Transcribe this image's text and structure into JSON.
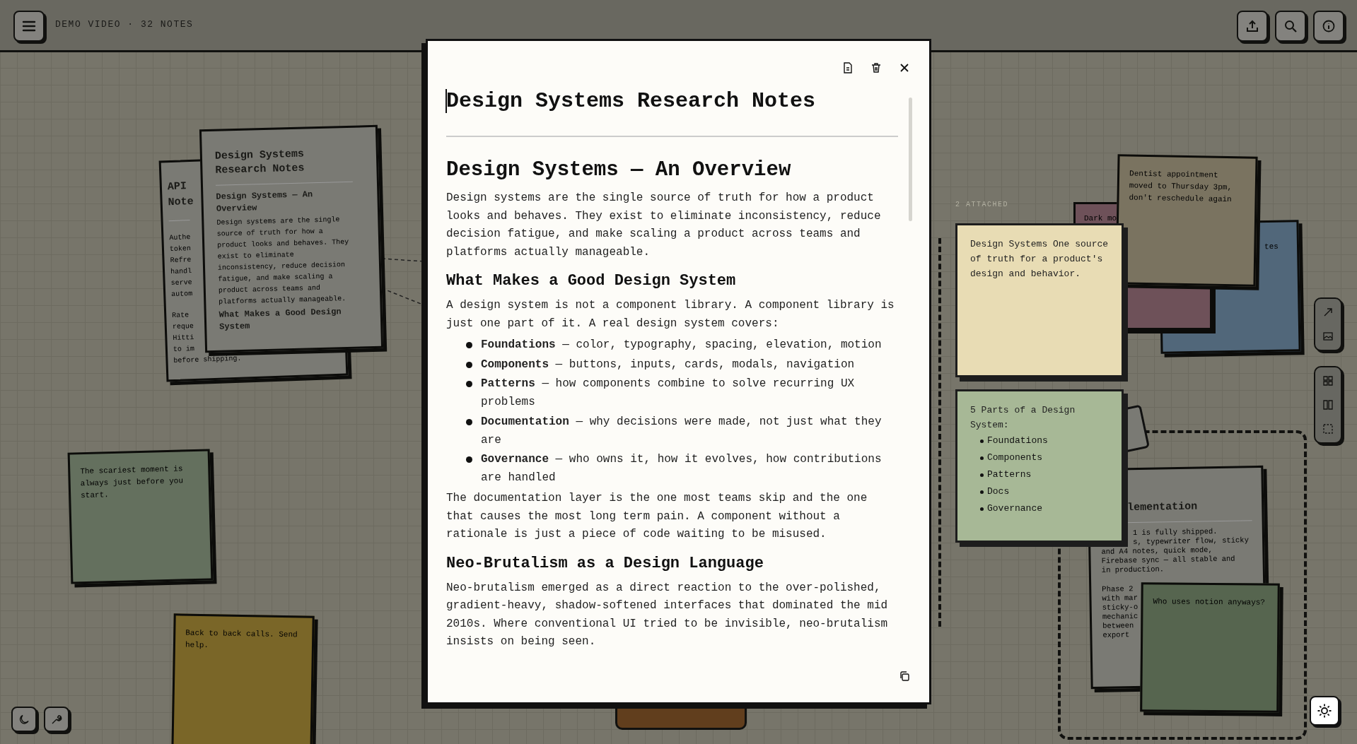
{
  "header": {
    "title": "DEMO VIDEO · 32 NOTES"
  },
  "canvas": {
    "attached_label": "2 ATTACHED",
    "notes": [
      {
        "kind": "doc",
        "title": "API Note",
        "paragraphs": [
          [
            "Authe",
            "token",
            "Refre",
            "handl",
            "serve",
            "autom"
          ],
          [
            "Rate",
            "reque",
            "Hitti",
            "to im",
            "before shipping."
          ]
        ],
        "highlighted": false,
        "color": "#7a7a74"
      },
      {
        "kind": "doc",
        "title": "Design Systems Research Notes",
        "heading": "Design Systems — An Overview",
        "text": "Design systems are the single source of truth for how a product looks and behaves. They exist to eliminate inconsistency, reduce decision fatigue, and make scaling a product across teams and platforms actually manageable.",
        "subheading": "What Makes a Good Design System",
        "highlighted": false,
        "color": "#7a7a74"
      },
      {
        "kind": "sticky",
        "text": "The scariest moment is always just before you start.",
        "highlighted": false,
        "color": "#64705e"
      },
      {
        "kind": "sticky",
        "text": "Back to back calls. Send help.",
        "highlighted": false,
        "color": "#7a6628"
      },
      {
        "kind": "sticky",
        "text": "Dark mo",
        "highlighted": false,
        "color": "#6e5159"
      },
      {
        "kind": "sticky",
        "text": "tes",
        "highlighted": false,
        "color": "#51677a"
      },
      {
        "kind": "sticky",
        "text": "Dentist appointment moved to Thursday 3pm, don't reschedule again",
        "highlighted": false,
        "color": "#7a7360"
      },
      {
        "kind": "sticky",
        "text": "Design Systems One source of truth for a product's design and behavior.",
        "highlighted": true,
        "color": "#e8dcb4"
      },
      {
        "kind": "sticky",
        "text": "5 Parts of a Design System:",
        "items": [
          "Foundations",
          "Components",
          "Patterns",
          "Docs",
          "Governance"
        ],
        "highlighted": true,
        "color": "#a7b896"
      },
      {
        "kind": "doc",
        "title": "lementation",
        "paragraphs": [
          [
            "1 is fully shipped.",
            "s, typewriter flow, sticky",
            "and A4 notes, quick mode,",
            "Firebase sync — all stable and",
            "in production."
          ],
          [
            "Phase 2",
            "with mar",
            "sticky-o",
            "mechanic",
            "between",
            "export"
          ]
        ],
        "highlighted": false,
        "color": "#7a7a74"
      },
      {
        "kind": "sticky",
        "text": "Who uses notion anyways?",
        "highlighted": false,
        "color": "#56654f"
      }
    ]
  },
  "modal": {
    "title": "Design Systems Research Notes",
    "content": [
      {
        "kind": "h1",
        "text": "Design Systems — An Overview"
      },
      {
        "kind": "p",
        "text": "Design systems are the single source of truth for how a product looks and behaves. They exist to eliminate inconsistency, reduce decision fatigue, and make scaling a product across teams and platforms actually manageable."
      },
      {
        "kind": "h2",
        "text": "What Makes a Good Design System"
      },
      {
        "kind": "p",
        "text": "A design system is not a component library. A component library is just one part of it. A real design system covers:"
      },
      {
        "kind": "list",
        "items": [
          "**Foundations** — color, typography, spacing, elevation, motion",
          "**Components** — buttons, inputs, cards, modals, navigation",
          "**Patterns** — how components combine to solve recurring UX problems",
          "**Documentation** — why decisions were made, not just what they are",
          "**Governance** — who owns it, how it evolves, how contributions are handled"
        ]
      },
      {
        "kind": "p",
        "text": "The documentation layer is the one most teams skip and the one that causes the most long term pain. A component without a rationale is just a piece of code waiting to be misused."
      },
      {
        "kind": "h2",
        "text": "Neo-Brutalism as a Design Language"
      },
      {
        "kind": "p",
        "text": "Neo-brutalism emerged as a direct reaction to the over-polished, gradient-heavy, shadow-softened interfaces that dominated the mid 2010s. Where conventional UI tried to be invisible, neo-brutalism insists on being seen."
      }
    ]
  }
}
